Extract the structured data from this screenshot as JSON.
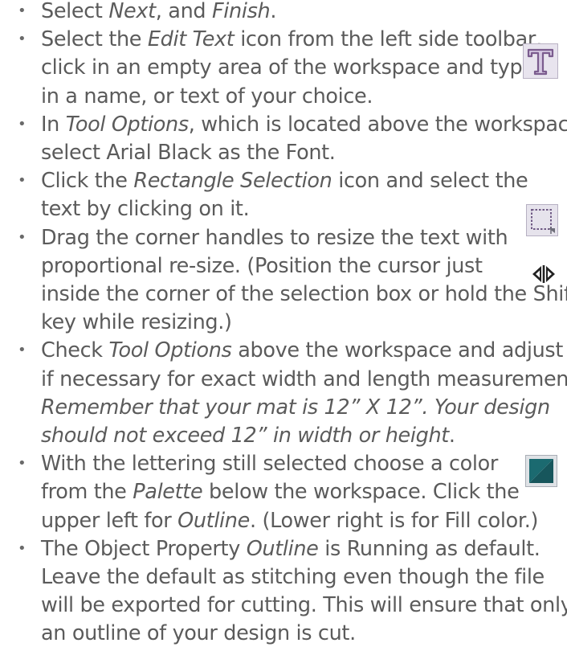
{
  "items": [
    {
      "lines": [
        [
          {
            "t": "Select "
          },
          {
            "t": "Next",
            "i": true
          },
          {
            "t": ", and "
          },
          {
            "t": "Finish",
            "i": true
          },
          {
            "t": "."
          }
        ]
      ]
    },
    {
      "icon": "edit-text-icon",
      "lines": [
        [
          {
            "t": "Select the "
          },
          {
            "t": "Edit Text",
            "i": true
          },
          {
            "t": " icon from the left side toolbar,"
          }
        ],
        [
          {
            "t": "click in an empty area of the workspace and type"
          }
        ],
        [
          {
            "t": "in a name, or text of your choice."
          }
        ]
      ]
    },
    {
      "lines": [
        [
          {
            "t": "In "
          },
          {
            "t": "Tool Options",
            "i": true
          },
          {
            "t": ", which is located above the workspace,"
          }
        ],
        [
          {
            "t": "select Arial Black as the Font."
          }
        ]
      ]
    },
    {
      "icon": "rectangle-selection-icon",
      "lines": [
        [
          {
            "t": "Click the "
          },
          {
            "t": "Rectangle Selection",
            "i": true
          },
          {
            "t": " icon and select the"
          }
        ],
        [
          {
            "t": "text by clicking on it."
          }
        ]
      ]
    },
    {
      "icon": "resize-handle-icon",
      "lines": [
        [
          {
            "t": "Drag the corner handles to resize the text with"
          }
        ],
        [
          {
            "t": "proportional re-size. (Position the cursor just"
          }
        ],
        [
          {
            "t": "inside the corner of the selection box or hold the Shift"
          }
        ],
        [
          {
            "t": "key while resizing.)"
          }
        ]
      ]
    },
    {
      "lines": [
        [
          {
            "t": "Check "
          },
          {
            "t": "Tool Options",
            "i": true
          },
          {
            "t": " above the workspace and adjust"
          }
        ],
        [
          {
            "t": "if necessary for exact width and length measurements."
          }
        ],
        [
          {
            "t": "Remember that your mat is 12” X 12”. Your design",
            "i": true
          }
        ],
        [
          {
            "t": "should not exceed 12” in width or height",
            "i": true
          },
          {
            "t": "."
          }
        ]
      ]
    },
    {
      "icon": "color-palette-icon",
      "lines": [
        [
          {
            "t": "With the lettering still selected choose a color"
          }
        ],
        [
          {
            "t": "from the "
          },
          {
            "t": "Palette",
            "i": true
          },
          {
            "t": " below the workspace. Click the"
          }
        ],
        [
          {
            "t": "upper left for "
          },
          {
            "t": "Outline",
            "i": true
          },
          {
            "t": ". (Lower right is for Fill color.)"
          }
        ]
      ]
    },
    {
      "lines": [
        [
          {
            "t": "The Object Property "
          },
          {
            "t": "Outline",
            "i": true
          },
          {
            "t": " is Running as default."
          }
        ],
        [
          {
            "t": "Leave the default as stitching even though the file"
          }
        ],
        [
          {
            "t": "will be exported for cutting. This will ensure that only"
          }
        ],
        [
          {
            "t": "an outline of your design is cut."
          }
        ]
      ]
    }
  ],
  "bullet_char": "•",
  "colors": {
    "text": "#5b5b5b",
    "icon_teal": "#1e6b6f",
    "icon_purple": "#7b5c8e"
  }
}
